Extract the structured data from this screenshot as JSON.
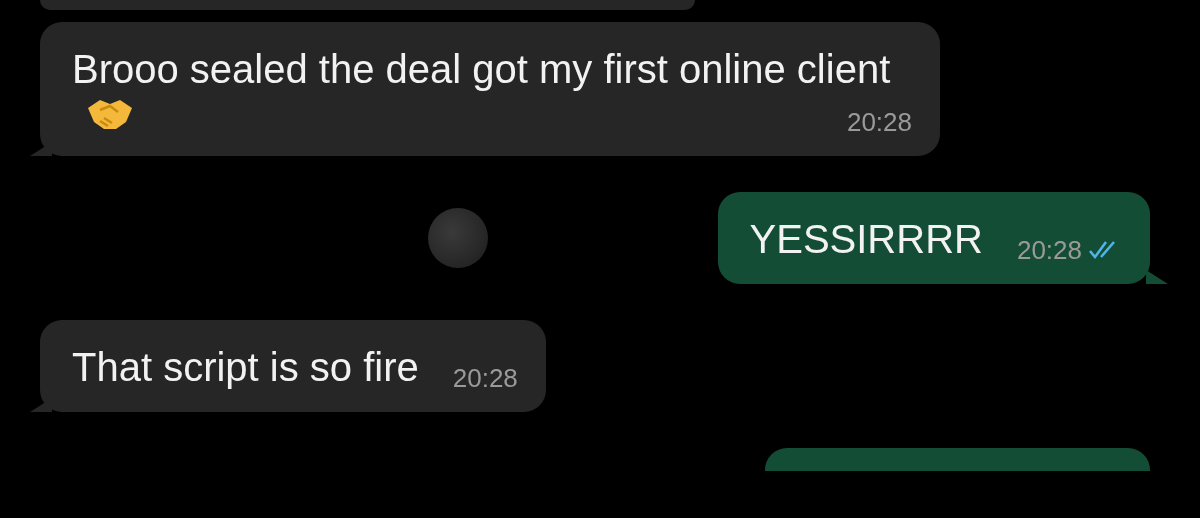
{
  "messages": [
    {
      "kind": "incoming",
      "partial": true
    },
    {
      "kind": "incoming",
      "text": "Brooo sealed the deal got my first online client",
      "emoji": true,
      "time": "20:28"
    },
    {
      "kind": "outgoing",
      "text": "YESSIRRRR",
      "time": "20:28",
      "read": true,
      "sticker": true
    },
    {
      "kind": "incoming",
      "text": "That script is so fire",
      "time": "20:28"
    },
    {
      "kind": "outgoing",
      "partial": true
    }
  ]
}
